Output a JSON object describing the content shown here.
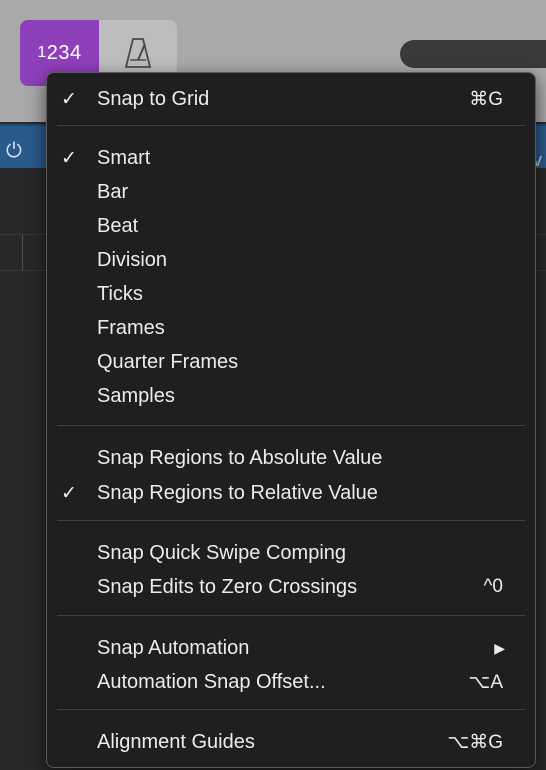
{
  "toolbar": {
    "lcd_label_a": "1",
    "lcd_label_b": "234",
    "metronome_icon": "metronome-icon",
    "power_icon": "power-icon"
  },
  "menu": {
    "items": [
      {
        "label": "Snap to Grid",
        "checked": "✓",
        "shortcut": "⌘G"
      },
      {
        "label": "Smart",
        "checked": "✓",
        "shortcut": ""
      },
      {
        "label": "Bar",
        "checked": "",
        "shortcut": ""
      },
      {
        "label": "Beat",
        "checked": "",
        "shortcut": ""
      },
      {
        "label": "Division",
        "checked": "",
        "shortcut": ""
      },
      {
        "label": "Ticks",
        "checked": "",
        "shortcut": ""
      },
      {
        "label": "Frames",
        "checked": "",
        "shortcut": ""
      },
      {
        "label": "Quarter Frames",
        "checked": "",
        "shortcut": ""
      },
      {
        "label": "Samples",
        "checked": "",
        "shortcut": ""
      },
      {
        "label": "Snap Regions to Absolute Value",
        "checked": "",
        "shortcut": ""
      },
      {
        "label": "Snap Regions to Relative Value",
        "checked": "✓",
        "shortcut": ""
      },
      {
        "label": "Snap Quick Swipe Comping",
        "checked": "",
        "shortcut": ""
      },
      {
        "label": "Snap Edits to Zero Crossings",
        "checked": "",
        "shortcut": "^0"
      },
      {
        "label": "Snap Automation",
        "checked": "",
        "shortcut": "▶"
      },
      {
        "label": "Automation Snap Offset...",
        "checked": "",
        "shortcut": "⌥A"
      },
      {
        "label": "Alignment Guides",
        "checked": "",
        "shortcut": "⌥⌘G"
      }
    ]
  },
  "colors": {
    "lcd_accent": "#8e3fba",
    "menu_bg": "#1f1f20",
    "strip_blue": "#2a5a8a"
  }
}
